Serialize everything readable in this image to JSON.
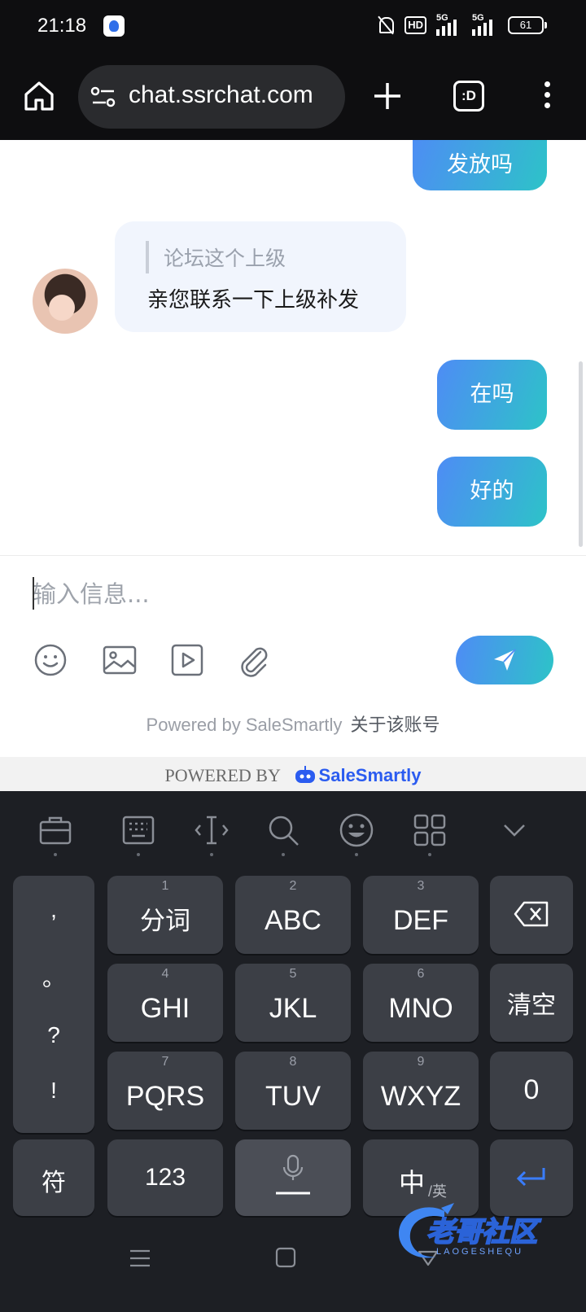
{
  "status_bar": {
    "time": "21:18",
    "network_hd": "HD",
    "signal_1": "5G",
    "signal_2": "5G",
    "battery": "61"
  },
  "browser": {
    "url": "chat.ssrchat.com",
    "tabs_label": ":D"
  },
  "chat": {
    "messages": [
      {
        "from": "me",
        "text": "发放吗"
      },
      {
        "from": "agent",
        "quote": "论坛这个上级",
        "text": "亲您联系一下上级补发"
      },
      {
        "from": "me",
        "text": "在吗"
      },
      {
        "from": "me",
        "text": "好的"
      }
    ]
  },
  "composer": {
    "placeholder": "输入信息...",
    "powered_by": "Powered by SaleSmartly",
    "about_account": "关于该账号"
  },
  "footer": {
    "powered_label": "POWERED BY",
    "brand": "SaleSmartly"
  },
  "keyboard": {
    "punctuation": [
      ",",
      "。",
      "?",
      "!"
    ],
    "rows": [
      [
        {
          "num": "1",
          "label": "分词"
        },
        {
          "num": "2",
          "label": "ABC"
        },
        {
          "num": "3",
          "label": "DEF"
        }
      ],
      [
        {
          "num": "4",
          "label": "GHI"
        },
        {
          "num": "5",
          "label": "JKL"
        },
        {
          "num": "6",
          "label": "MNO"
        }
      ],
      [
        {
          "num": "7",
          "label": "PQRS"
        },
        {
          "num": "8",
          "label": "TUV"
        },
        {
          "num": "9",
          "label": "WXYZ"
        }
      ]
    ],
    "clear_label": "清空",
    "zero_label": "0",
    "symbols_label": "符",
    "numbers_label": "123",
    "lang_main": "中",
    "lang_sub": "/英"
  },
  "watermark": {
    "text": "老哥社区",
    "sub": "LAOGESHEQU"
  }
}
